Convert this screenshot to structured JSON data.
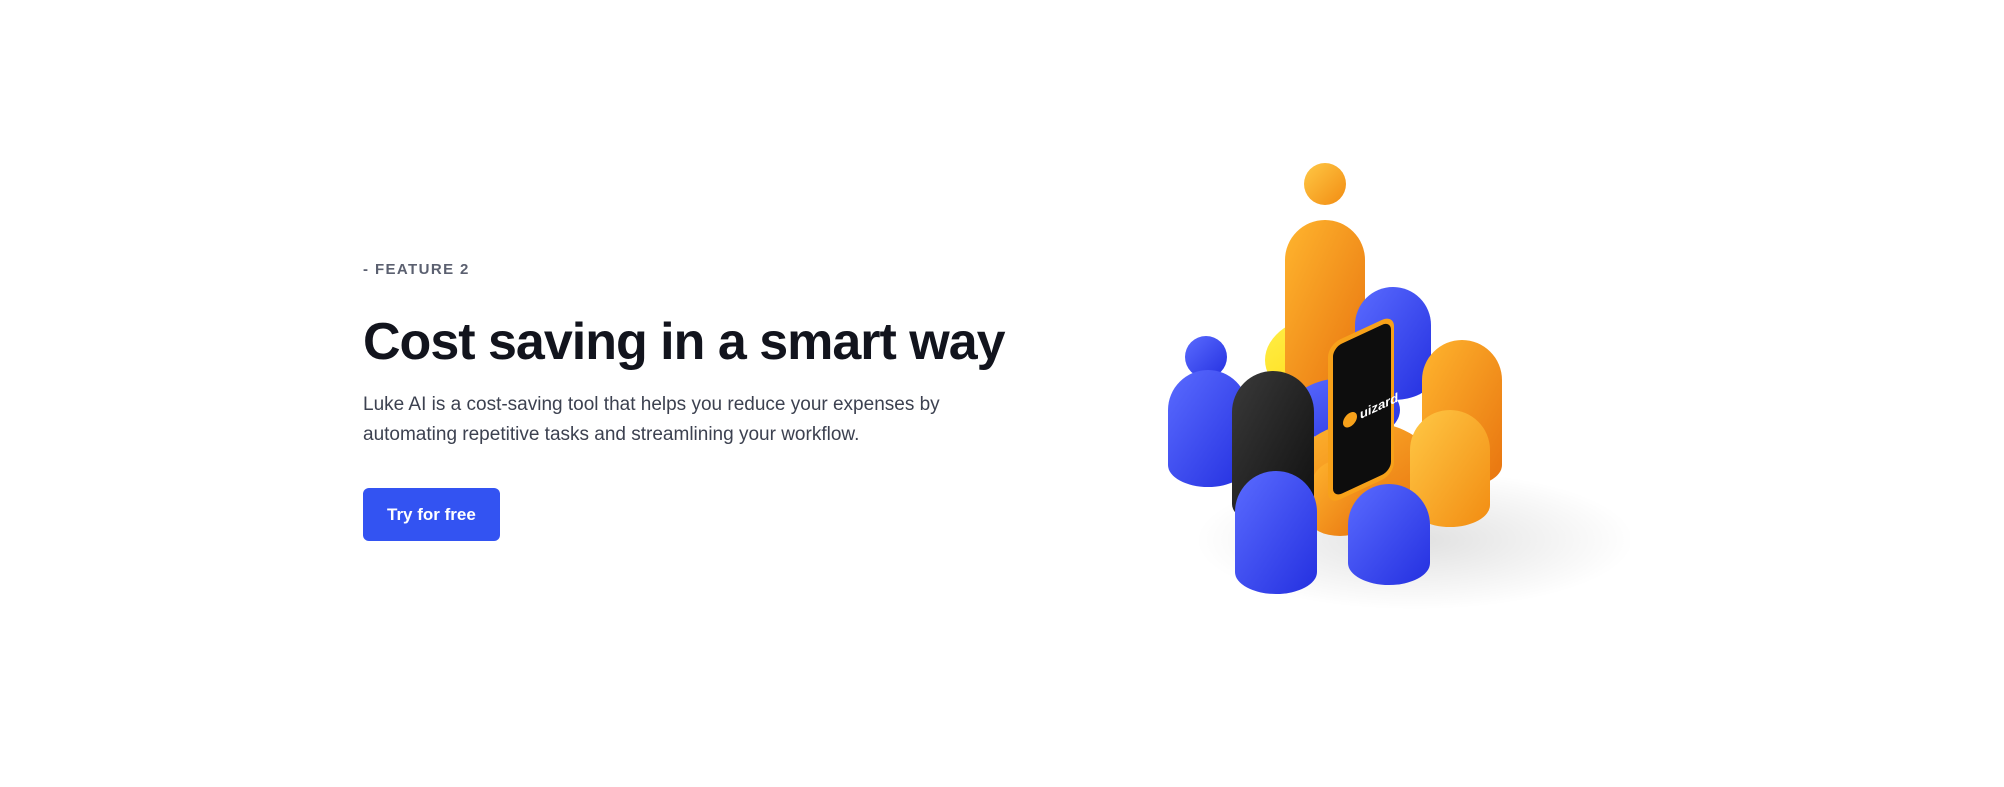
{
  "feature": {
    "eyebrow": "- FEATURE 2",
    "title": "Cost saving in a smart way",
    "description": "Luke AI is a cost-saving tool that helps you reduce your expenses by automating repetitive tasks and streamlining your workflow.",
    "cta_label": "Try for free"
  },
  "illustration": {
    "brand_text": "uizard",
    "icon_name": "isometric-people-illustration"
  },
  "colors": {
    "accent": "#3353f2",
    "orange": "#f7a11a",
    "blue": "#3346f5",
    "yellow": "#ffe21a",
    "black": "#1e1e1e"
  }
}
